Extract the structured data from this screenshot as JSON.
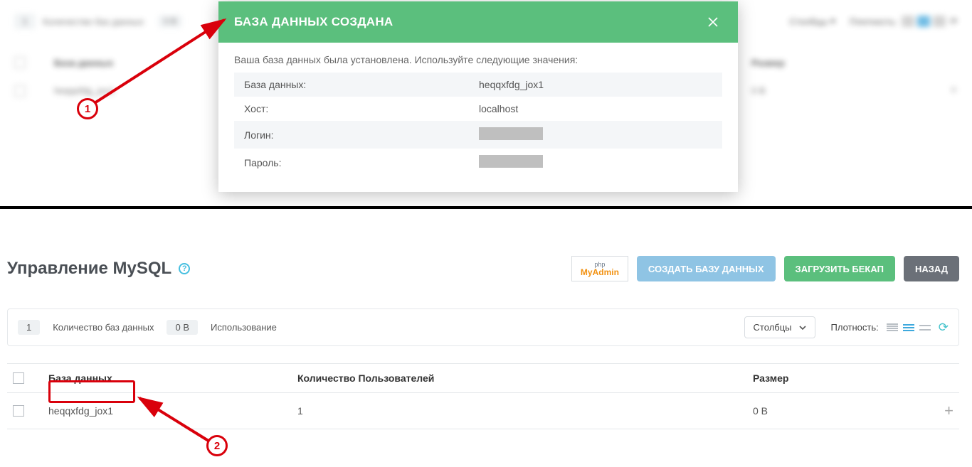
{
  "top_blur": {
    "count": "1",
    "count_label": "Количество баз данных",
    "usage_badge": "0 B",
    "columns_dd": "Столбцы",
    "density_label": "Плотность:",
    "head_col1": "База данных",
    "size_label": "Размер",
    "row_name": "heqqxfdg_jox1",
    "row_size": "0 B"
  },
  "modal": {
    "title": "БАЗА ДАННЫХ СОЗДАНА",
    "intro": "Ваша база данных была установлена. Используйте следующие значения:",
    "rows": [
      {
        "label": "База данных:",
        "value": "heqqxfdg_jox1"
      },
      {
        "label": "Хост:",
        "value": "localhost"
      },
      {
        "label": "Логин:",
        "value": "__SECRET__"
      },
      {
        "label": "Пароль:",
        "value": "__SECRET__"
      }
    ]
  },
  "annotations": {
    "step1": "1",
    "step2": "2"
  },
  "page": {
    "title": "Управление MySQL",
    "buttons": {
      "phpmyadmin_l1": "php",
      "phpmyadmin_l2": "MyAdmin",
      "create": "СОЗДАТЬ БАЗУ ДАННЫХ",
      "upload": "ЗАГРУЗИТЬ БЕКАП",
      "back": "НАЗАД"
    },
    "stats": {
      "count": "1",
      "count_label": "Количество баз данных",
      "usage": "0 B",
      "usage_label": "Использование",
      "columns": "Столбцы",
      "density_label": "Плотность:"
    },
    "table": {
      "headers": {
        "name": "База данных",
        "users": "Количество Пользователей",
        "size": "Размер"
      },
      "rows": [
        {
          "name": "heqqxfdg_jox1",
          "users": "1",
          "size": "0 B"
        }
      ]
    }
  }
}
